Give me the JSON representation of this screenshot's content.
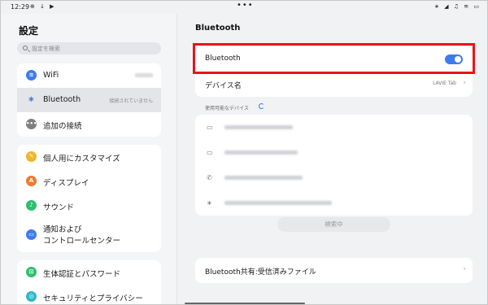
{
  "status_bar": {
    "time": "12:29",
    "left_icons": "⊕ ↓ ▶",
    "center_dots": "•••",
    "right_icons": "∗ ◢ ♫ ≋ ▭"
  },
  "left_panel": {
    "title": "設定",
    "search_placeholder": "設定を検索",
    "group1": [
      {
        "label": "WiFi",
        "sub": "",
        "icon": "wifi-icon",
        "color": "#3d7bf0"
      },
      {
        "label": "Bluetooth",
        "sub": "接続されていません",
        "icon": "bluetooth-icon",
        "color": "#3d7bf0"
      },
      {
        "label": "追加の接続",
        "sub": "",
        "icon": "more-connections-icon",
        "color": "#808080"
      }
    ],
    "group2": [
      {
        "label": "個人用にカスタマイズ",
        "icon": "customize-icon",
        "color": "#f0b52a"
      },
      {
        "label": "ディスプレイ",
        "icon": "display-icon",
        "color": "#f07a30"
      },
      {
        "label": "サウンド",
        "icon": "sound-icon",
        "color": "#2fbf71"
      },
      {
        "label": "通知および\nコントロールセンター",
        "icon": "notification-icon",
        "color": "#3d7bf0"
      }
    ],
    "group3": [
      {
        "label": "生体認証とパスワード",
        "icon": "lock-icon",
        "color": "#2fbf71"
      },
      {
        "label": "セキュリティとプライバシー",
        "icon": "security-icon",
        "color": "#2fb8c9"
      }
    ]
  },
  "right_panel": {
    "title": "Bluetooth",
    "bluetooth_row_label": "Bluetooth",
    "bluetooth_enabled": true,
    "device_name_label": "デバイス名",
    "device_name_value": "LAVIE Tab",
    "available_devices_label": "使用可能なデバイス",
    "devices": [
      {
        "icon": "monitor-icon"
      },
      {
        "icon": "monitor-icon"
      },
      {
        "icon": "phone-icon"
      },
      {
        "icon": "bluetooth-icon"
      }
    ],
    "scan_button_label": "検索中",
    "shared_files_label": "Bluetooth共有:受信済みファイル"
  },
  "colors": {
    "accent": "#3d7bf0",
    "highlight": "#e8141a"
  }
}
